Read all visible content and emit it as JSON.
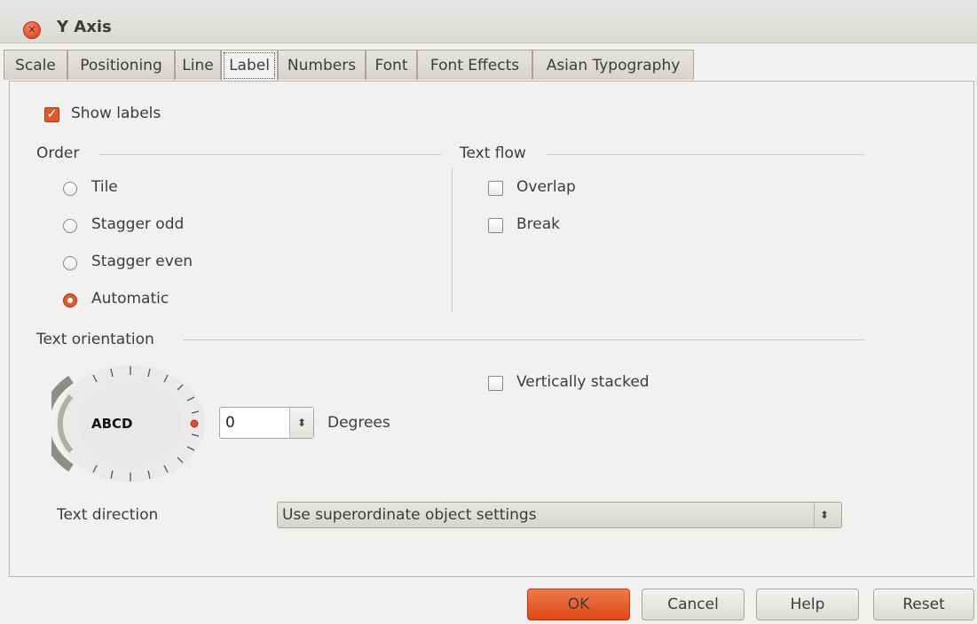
{
  "window": {
    "title": "Y Axis"
  },
  "tabs": [
    "Scale",
    "Positioning",
    "Line",
    "Label",
    "Numbers",
    "Font",
    "Font Effects",
    "Asian Typography"
  ],
  "active_tab": "Label",
  "show_labels": {
    "label": "Show labels",
    "checked": true
  },
  "order": {
    "heading": "Order",
    "options": [
      {
        "label": "Tile",
        "selected": false
      },
      {
        "label": "Stagger odd",
        "selected": false
      },
      {
        "label": "Stagger even",
        "selected": false
      },
      {
        "label": "Automatic",
        "selected": true
      }
    ]
  },
  "text_flow": {
    "heading": "Text flow",
    "overlap": {
      "label": "Overlap",
      "checked": false
    },
    "break": {
      "label": "Break",
      "checked": false
    }
  },
  "text_orientation": {
    "heading": "Text orientation",
    "dial_text": "ABCD",
    "degrees_value": "0",
    "degrees_label": "Degrees",
    "vertically_stacked": {
      "label": "Vertically stacked",
      "checked": false
    }
  },
  "text_direction": {
    "label": "Text direction",
    "selected": "Use superordinate object settings"
  },
  "buttons": {
    "ok": "OK",
    "cancel": "Cancel",
    "help": "Help",
    "reset": "Reset"
  },
  "colors": {
    "accent": "#e05a2b",
    "background": "#f2f1f0"
  }
}
